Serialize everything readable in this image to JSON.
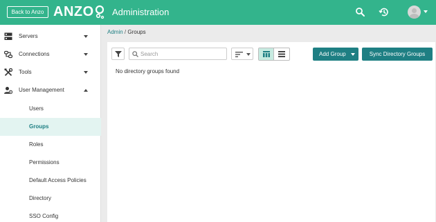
{
  "header": {
    "back_label": "Back to Anzo",
    "logo_text": "ANZO",
    "title": "Administration",
    "icons": [
      "search-icon",
      "history-icon",
      "user-avatar-icon"
    ],
    "brand_color": "#33b48c"
  },
  "sidebar": {
    "items": [
      {
        "label": "Servers",
        "icon": "server-icon",
        "expanded": false
      },
      {
        "label": "Connections",
        "icon": "connections-icon",
        "expanded": false
      },
      {
        "label": "Tools",
        "icon": "tools-icon",
        "expanded": false
      },
      {
        "label": "User Management",
        "icon": "user-management-icon",
        "expanded": true
      }
    ],
    "sub_items": [
      {
        "label": "Users",
        "active": false
      },
      {
        "label": "Groups",
        "active": true
      },
      {
        "label": "Roles",
        "active": false
      },
      {
        "label": "Permissions",
        "active": false
      },
      {
        "label": "Default Access Policies",
        "active": false
      },
      {
        "label": "Directory",
        "active": false
      },
      {
        "label": "SSO Config",
        "active": false
      }
    ]
  },
  "breadcrumb": {
    "parent": "Admin",
    "separator": "/",
    "current": "Groups"
  },
  "toolbar": {
    "search_placeholder": "Search",
    "search_value": "",
    "view_mode": "grid",
    "add_group_label": "Add Group",
    "sync_label": "Sync Directory Groups",
    "accent_color": "#1e7f83"
  },
  "content": {
    "empty_message": "No directory groups found"
  }
}
